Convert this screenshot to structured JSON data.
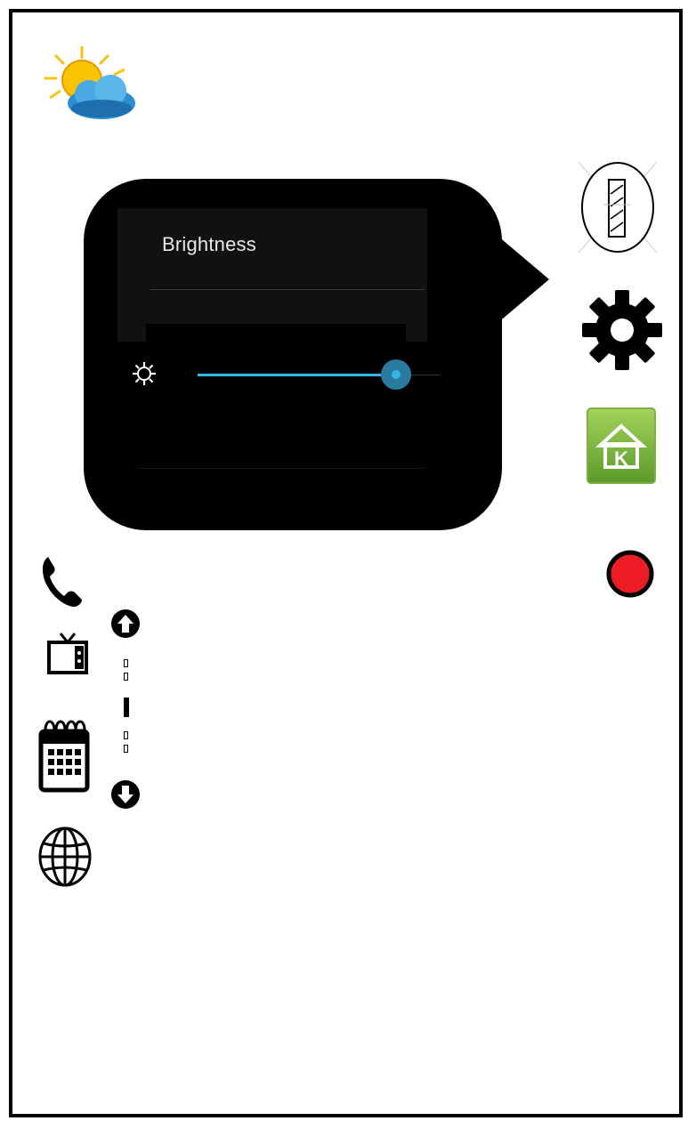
{
  "brightness_dialog": {
    "title": "Brightness",
    "level": 0.95
  },
  "icons": {
    "weather": "partly-sunny-weather-icon",
    "flashlight": "flashlight-icon",
    "settings": "gear-icon",
    "app": "green-app-icon",
    "record": "record-icon",
    "phone": "phone-icon",
    "tv": "tv-icon",
    "calendar": "calendar-icon",
    "globe": "globe-icon",
    "scroll_up": "arrow-up-icon",
    "scroll_down": "arrow-down-icon"
  },
  "colors": {
    "accent": "#33b5e5",
    "record": "#ee1c25",
    "app_green": "#8bc34a"
  }
}
